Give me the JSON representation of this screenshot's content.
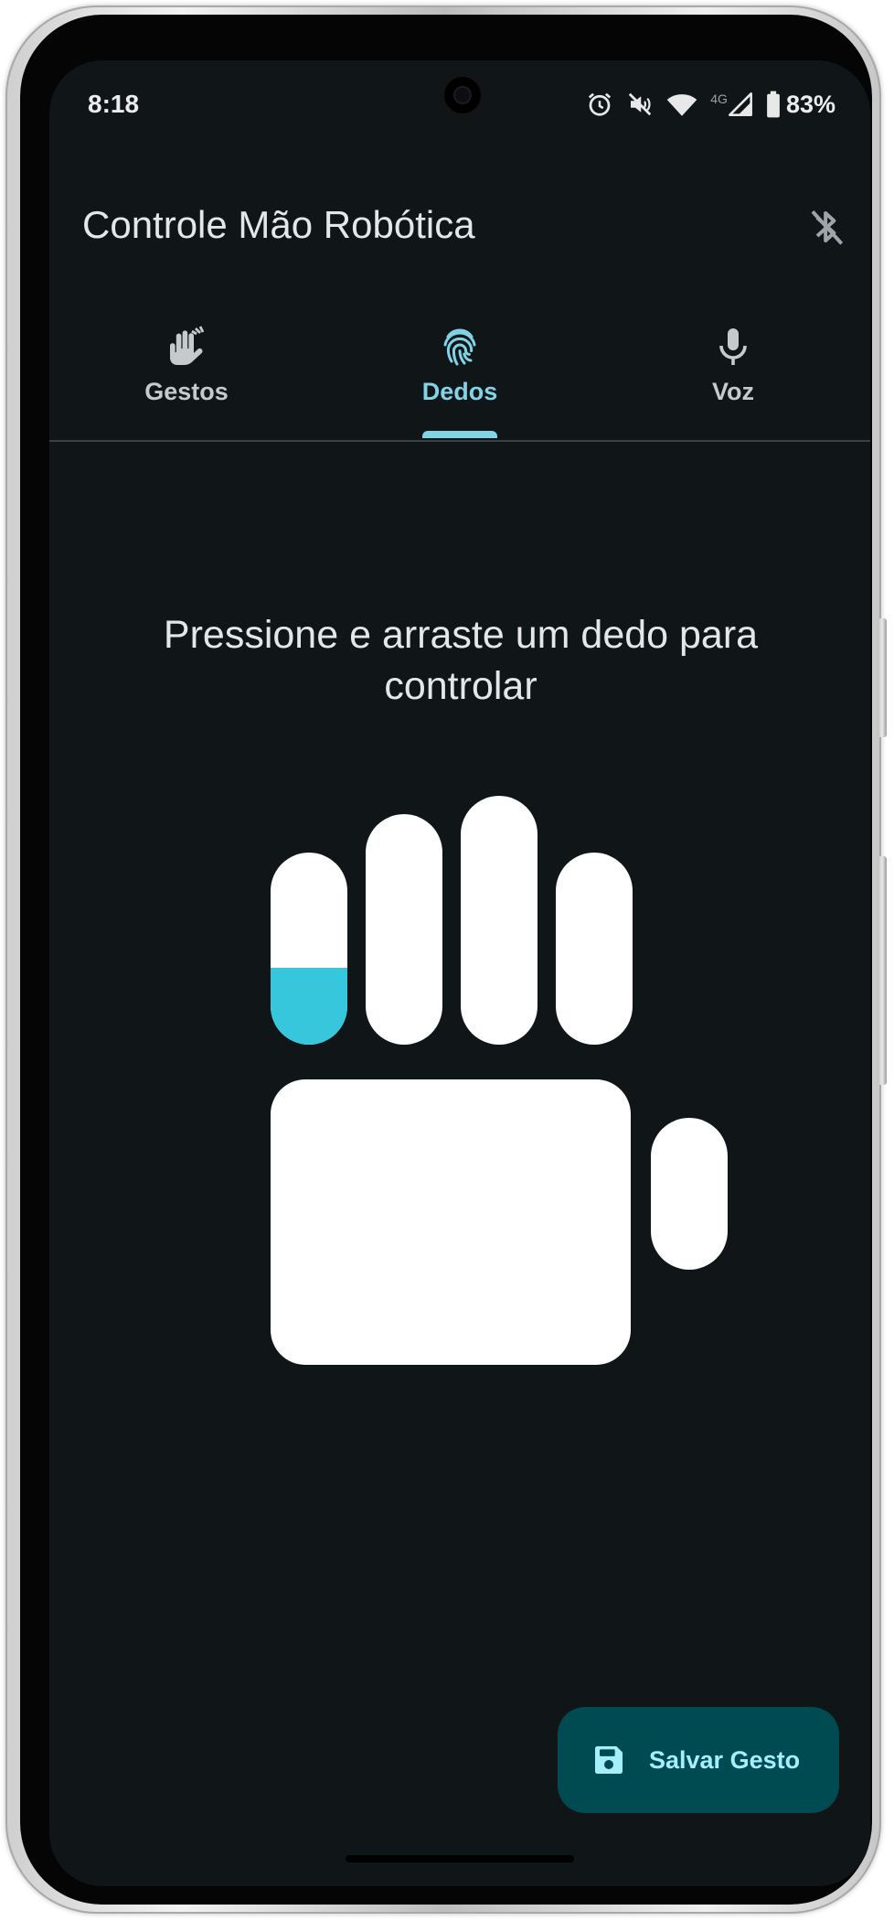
{
  "status_bar": {
    "time": "8:18",
    "network": "4G",
    "battery": "83%",
    "icons": [
      "alarm-icon",
      "mute-icon",
      "wifi-icon",
      "signal-icon",
      "battery-icon"
    ]
  },
  "app_bar": {
    "title": "Controle Mão Robótica",
    "bluetooth_icon": "bluetooth-disabled-icon"
  },
  "tabs": [
    {
      "label": "Gestos",
      "icon": "hand-gesture-icon",
      "active": false
    },
    {
      "label": "Dedos",
      "icon": "fingerprint-icon",
      "active": true
    },
    {
      "label": "Voz",
      "icon": "microphone-icon",
      "active": false
    }
  ],
  "main": {
    "instruction": "Pressione e arraste um dedo para controlar"
  },
  "hand": {
    "fingers": [
      {
        "name": "finger-1",
        "level": 0.4
      },
      {
        "name": "finger-2",
        "level": 0
      },
      {
        "name": "finger-3",
        "level": 0
      },
      {
        "name": "finger-4",
        "level": 0
      },
      {
        "name": "thumb",
        "level": 0
      }
    ],
    "fill_color": "#37c7dd"
  },
  "fab": {
    "label": "Salvar Gesto",
    "icon": "save-icon"
  },
  "colors": {
    "background": "#101518",
    "accent": "#81d4e6",
    "fab_background": "#004a52"
  }
}
